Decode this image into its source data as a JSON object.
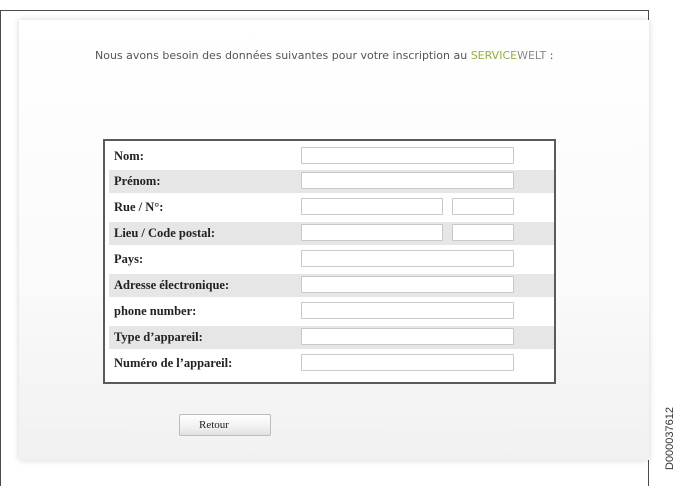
{
  "intro": {
    "text": "Nous avons besoin des données suivantes pour votre inscription au ",
    "brand_service": "SERVICE",
    "brand_welt": "WELT",
    "suffix": " :"
  },
  "form": {
    "fields": [
      {
        "label": "Nom:",
        "value": ""
      },
      {
        "label": "Prénom:",
        "value": ""
      },
      {
        "label": "Rue / N°:",
        "value": "",
        "value2": ""
      },
      {
        "label": "Lieu / Code postal:",
        "value": "",
        "value2": ""
      },
      {
        "label": "Pays:",
        "value": ""
      },
      {
        "label": "Adresse électronique:",
        "value": ""
      },
      {
        "label": "phone number:",
        "value": ""
      },
      {
        "label": "Type d’appareil:",
        "value": ""
      },
      {
        "label": "Numéro de l’appareil:",
        "value": ""
      }
    ]
  },
  "buttons": {
    "back_label": "Retour"
  },
  "document_id": "D000037612",
  "colors": {
    "brand_green": "#8fb23a",
    "row_shade": "#e6e6e6",
    "border": "#5a5a5a"
  }
}
